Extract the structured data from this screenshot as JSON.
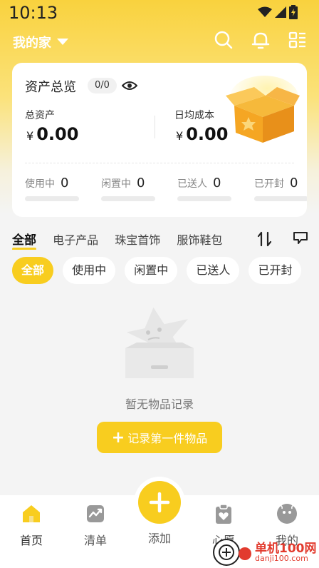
{
  "status_bar": {
    "time": "10:13"
  },
  "header": {
    "home_name": "我的家"
  },
  "asset_card": {
    "title": "资产总览",
    "count": "0/0",
    "total_label": "总资产",
    "total_currency": "¥",
    "total_value": "0.00",
    "daily_label": "日均成本",
    "daily_currency": "¥",
    "daily_value": "0.00",
    "stats": [
      {
        "label": "使用中",
        "value": "0"
      },
      {
        "label": "闲置中",
        "value": "0"
      },
      {
        "label": "已送人",
        "value": "0"
      },
      {
        "label": "已开封",
        "value": "0"
      }
    ]
  },
  "category_tabs": [
    "全部",
    "电子产品",
    "珠宝首饰",
    "服饰鞋包"
  ],
  "status_chips": [
    "全部",
    "使用中",
    "闲置中",
    "已送人",
    "已开封"
  ],
  "empty_state": {
    "message": "暂无物品记录",
    "button_label": "记录第一件物品",
    "button_plus": "+"
  },
  "bottom_nav": {
    "home": "首页",
    "list": "清单",
    "add": "添加",
    "wish": "心愿",
    "mine": "我的"
  },
  "watermark": {
    "line1": "单机100网",
    "line2": "danji100.com"
  },
  "colors": {
    "accent": "#f8cd1f",
    "background": "#f4f4f4"
  },
  "icons": [
    "wifi-icon",
    "signal-icon",
    "battery-icon",
    "chevron-down-icon",
    "search-icon",
    "bell-icon",
    "grid-menu-icon",
    "eye-icon",
    "sort-icon",
    "filter-icon",
    "home-icon",
    "list-icon",
    "plus-icon",
    "wish-icon",
    "profile-icon"
  ]
}
